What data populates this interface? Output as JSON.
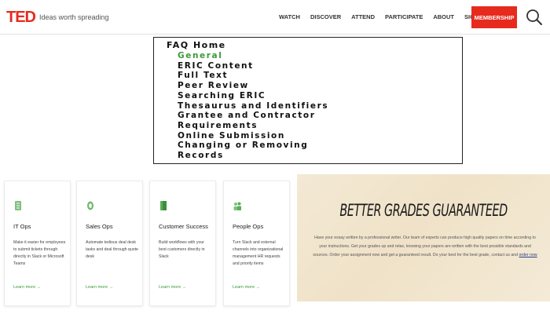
{
  "header": {
    "logo": "TED",
    "tagline": "Ideas worth spreading",
    "nav": [
      "WATCH",
      "DISCOVER",
      "ATTEND",
      "PARTICIPATE",
      "ABOUT",
      "SIGN IN"
    ],
    "membership_label": "MEMBERSHIP",
    "brand_color": "#e62b1e"
  },
  "faq": {
    "title": "FAQ Home",
    "items": [
      "General",
      "ERIC Content",
      "Full Text",
      "Peer Review",
      "Searching ERIC",
      "Thesaurus and Identifiers",
      "Grantee and Contractor",
      "Requirements",
      "Online Submission",
      "Changing or Removing",
      "Records"
    ],
    "active_index": 0,
    "active_color": "#3a9a3a"
  },
  "cards": [
    {
      "icon": "book-icon",
      "title": "IT Ops",
      "desc": "Make it easier for employees to submit tickets through directly in Slack or Microsoft Teams",
      "link": "Learn more →"
    },
    {
      "icon": "layers-icon",
      "title": "Sales Ops",
      "desc": "Automate tedious deal desk tasks and deal through quote desk",
      "link": "Learn more →"
    },
    {
      "icon": "document-icon",
      "title": "Customer Success",
      "desc": "Build workflows with your best customers directly in Slack",
      "link": "Learn more →"
    },
    {
      "icon": "people-icon",
      "title": "People Ops",
      "desc": "Turn Slack and external channels into organizational management HR requests and priority items",
      "link": "Learn more →"
    }
  ],
  "promo": {
    "title": "BETTER GRADES GUARANTEED",
    "text": "Have your essay written by a professional writer. Our team of experts can produce high quality papers on time according to your instructions. Get your grades up and relax, knowing your papers are written with the best possible standards and sources. Order your assignment now and get a guaranteed result. Do your best for the best grade, contact us and",
    "link": "order now"
  }
}
